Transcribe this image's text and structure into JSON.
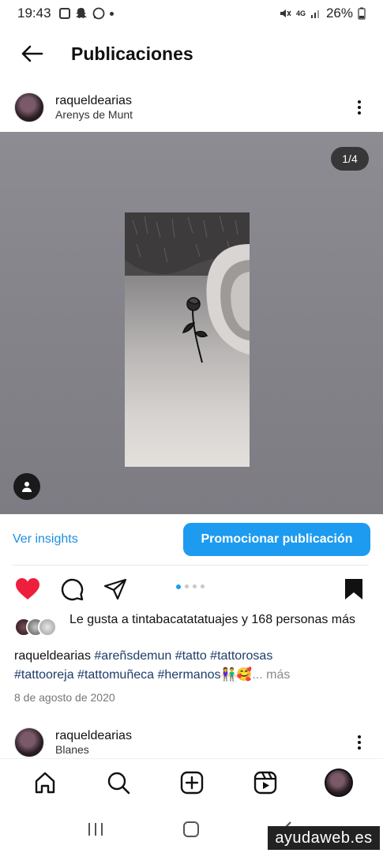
{
  "status_bar": {
    "time": "19:43",
    "battery": "26%",
    "network": "4G"
  },
  "header": {
    "title": "Publicaciones"
  },
  "post": {
    "username": "raqueldearias",
    "location": "Arenys de Munt",
    "image_counter": "1/4",
    "insights_label": "Ver insights",
    "promote_label": "Promocionar publicación",
    "carousel_position": 1,
    "carousel_total": 4,
    "likes": {
      "prefix": "Le gusta a ",
      "liked_by": "tintabacatatatuajes",
      "suffix": " y 168 personas más"
    },
    "caption": {
      "username": "raqueldearias",
      "hashtags_line1": "#areñsdemun #tatto #tattorosas",
      "hashtags_line2": "#tattooreja #tattomuñeca #hermanos",
      "emoji": "👫🥰",
      "more_label": "... más"
    },
    "date": "8 de agosto de 2020"
  },
  "next_post": {
    "username": "raqueldearias",
    "location": "Blanes"
  },
  "watermark": "ayudaweb.es",
  "colors": {
    "accent": "#1d9bf0",
    "like": "#ed1f3c",
    "hashtag": "#1c3d6a"
  },
  "icons": {
    "back": "arrow-left-icon",
    "more": "kebab-icon",
    "like": "heart-filled-icon",
    "comment": "comment-icon",
    "share": "send-icon",
    "save": "bookmark-filled-icon",
    "home": "home-icon",
    "search": "search-icon",
    "create": "plus-square-icon",
    "reels": "reels-icon"
  }
}
